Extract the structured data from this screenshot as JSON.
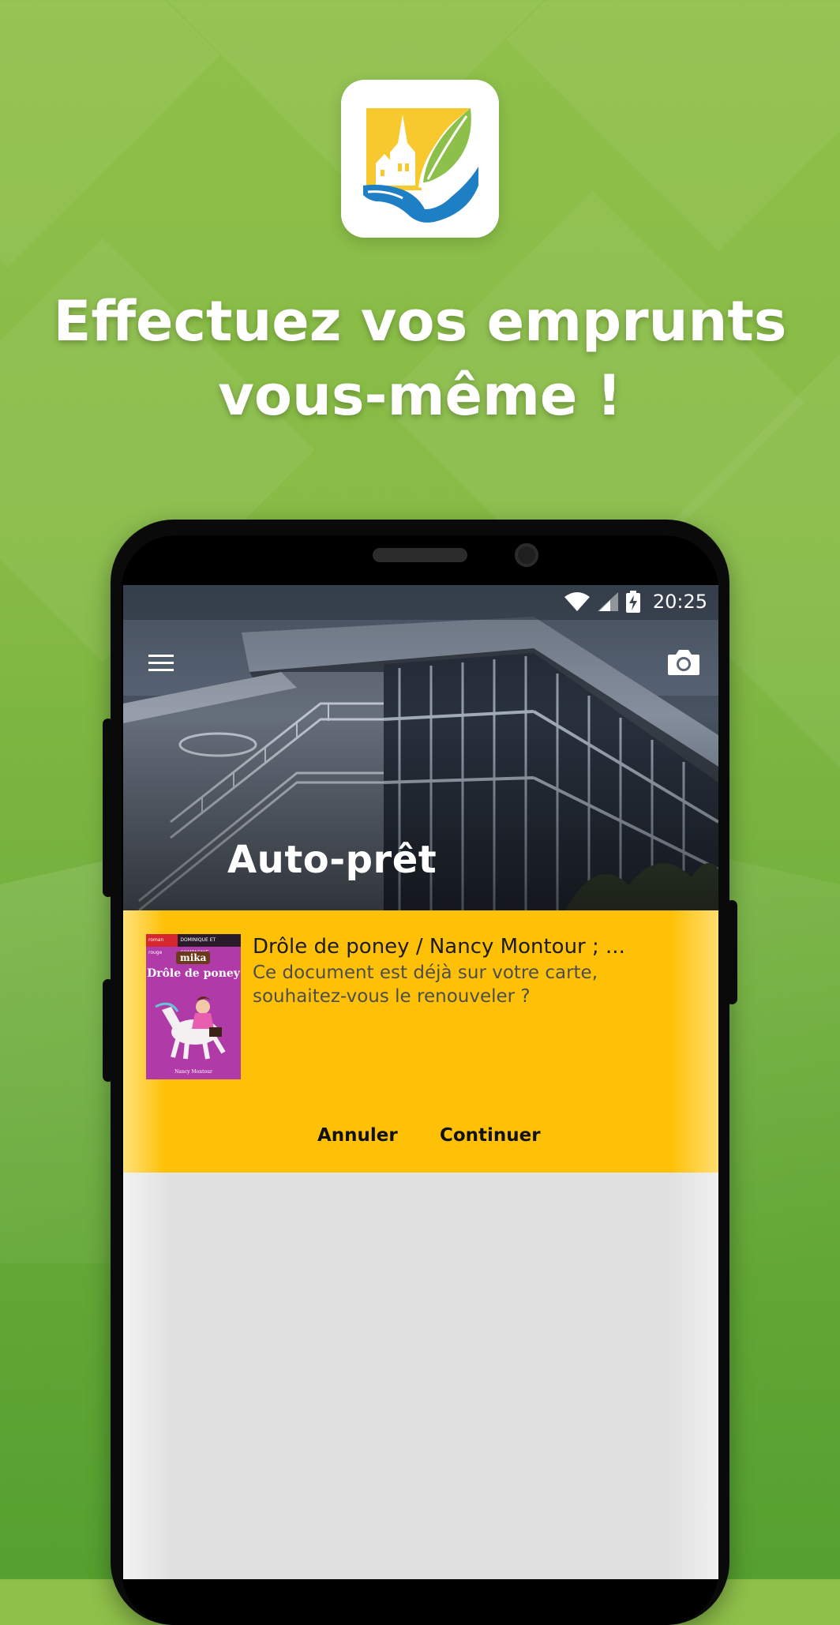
{
  "headline": {
    "line1": "Effectuez vos emprunts",
    "line2": "vous-même !"
  },
  "status_bar": {
    "time": "20:25",
    "icons": [
      "wifi-icon",
      "signal-icon",
      "battery-charging-icon"
    ]
  },
  "app_header": {
    "title": "Auto-prêt",
    "menu_icon": "menu-icon",
    "camera_icon": "camera-icon"
  },
  "document_dialog": {
    "cover": {
      "series_tag": "roman rouge",
      "publisher": "DOMINIQUE ET COMPAGNIE",
      "brand": "mika",
      "title": "Drôle de poney",
      "author": "Nancy Montour"
    },
    "title": "Drôle de poney / Nancy Montour ; ...",
    "message": "Ce document est déjà sur votre carte, souhaitez-vous le renouveler ?",
    "cancel_label": "Annuler",
    "continue_label": "Continuer"
  },
  "colors": {
    "background_green": "#86bb45",
    "card_yellow": "#ffc107",
    "logo_yellow": "#f7c92e",
    "logo_blue": "#1e7fc4",
    "logo_green": "#8cc04b"
  }
}
